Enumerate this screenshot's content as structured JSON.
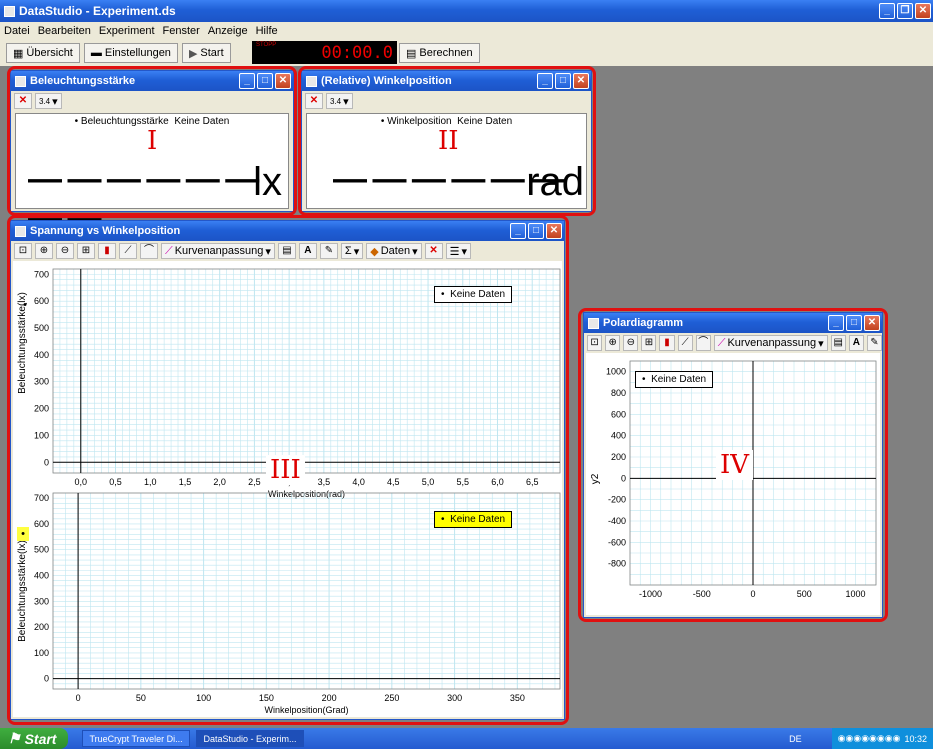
{
  "app": {
    "title": "DataStudio - Experiment.ds"
  },
  "menu": [
    "Datei",
    "Bearbeiten",
    "Experiment",
    "Fenster",
    "Anzeige",
    "Hilfe"
  ],
  "toolbar": {
    "overview": "Übersicht",
    "settings": "Einstellungen",
    "start": "Start",
    "stop_label": "STOPP",
    "timer": "00:00.0",
    "calc": "Berechnen"
  },
  "panel1": {
    "title": "Beleuchtungsstärke",
    "legend": "• Beleuchtungsstärke",
    "nodata": "Keine Daten",
    "value": "— — — — — — — —",
    "unit": "lx",
    "label": "I"
  },
  "panel2": {
    "title": "(Relative) Winkelposition",
    "legend": "• Winkelposition",
    "nodata": "Keine Daten",
    "value": "— — — — — —",
    "unit": "rad",
    "label": "II"
  },
  "panel3": {
    "title": "Spannung vs Winkelposition",
    "curve_fit": "Kurvenanpassung",
    "data_label": "Daten",
    "label": "III",
    "sigma": "Σ",
    "letter_a": "A"
  },
  "panel4": {
    "title": "Polardiagramm",
    "curve_fit": "Kurvenanpassung",
    "label": "IV",
    "letter_a": "A"
  },
  "chart_data": [
    {
      "type": "line",
      "title": "",
      "xlabel": "Winkelposition(rad)",
      "ylabel": "Beleuchtungsstärke(lx)",
      "x_ticks": [
        "0,0",
        "0,5",
        "1,0",
        "1,5",
        "2,0",
        "2,5",
        "3,0",
        "3,5",
        "4,0",
        "4,5",
        "5,0",
        "5,5",
        "6,0",
        "6,5"
      ],
      "y_ticks": [
        "0",
        "100",
        "200",
        "300",
        "400",
        "500",
        "600",
        "700"
      ],
      "xlim": [
        -0.4,
        6.9
      ],
      "ylim": [
        -40,
        720
      ],
      "legend": "Keine Daten",
      "series": []
    },
    {
      "type": "line",
      "title": "",
      "xlabel": "Winkelposition(Grad)",
      "ylabel": "Beleuchtungsstärke(lx)",
      "x_ticks": [
        "0",
        "50",
        "100",
        "150",
        "200",
        "250",
        "300",
        "350"
      ],
      "y_ticks": [
        "0",
        "100",
        "200",
        "300",
        "400",
        "500",
        "600",
        "700"
      ],
      "xlim": [
        -20,
        384
      ],
      "ylim": [
        -40,
        720
      ],
      "legend": "Keine Daten",
      "series": []
    },
    {
      "type": "scatter",
      "title": "",
      "xlabel": "",
      "ylabel": "y2",
      "x_ticks": [
        "-1000",
        "-500",
        "0",
        "500",
        "1000"
      ],
      "y_ticks": [
        "1000",
        "800",
        "600",
        "400",
        "200",
        "0",
        "-200",
        "-400",
        "-600",
        "-800"
      ],
      "xlim": [
        -1200,
        1200
      ],
      "ylim": [
        -1000,
        1100
      ],
      "legend": "Keine Daten",
      "series": []
    }
  ],
  "taskbar": {
    "start": "Start",
    "tasks": [
      "TrueCrypt Traveler Di...",
      "DataStudio - Experim..."
    ],
    "lang": "DE",
    "clock": "10:32"
  }
}
